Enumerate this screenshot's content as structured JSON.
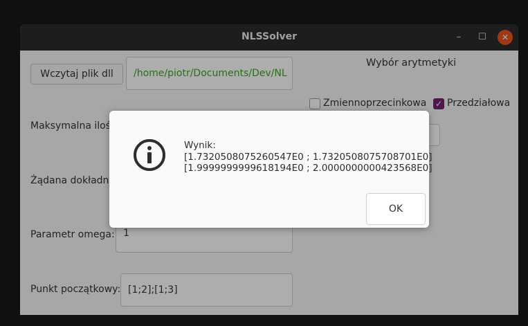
{
  "window": {
    "title": "NLSSolver",
    "minimize_glyph": "–",
    "maximize_glyph": "☐",
    "close_glyph": "✕"
  },
  "main": {
    "load_button_label": "Wczytaj plik dll",
    "dll_path_value": "/home/piotr/Documents/Dev/NL",
    "arithmetic_heading": "Wybór arytmetyki",
    "floating_label": "Zmiennoprzecinkowa",
    "interval_label": "Przedziałowa",
    "floating_checked": false,
    "interval_checked": true,
    "max_iter_label": "Maksymalna ilość iteracji:",
    "epsilon_label": "Żądana dokładność:",
    "omega_label": "Parametr omega:",
    "omega_value": "1",
    "start_point_label": "Punkt początkowy:",
    "start_point_value": "[1;2];[1;3]",
    "path_text_color": "#3aa61f"
  },
  "dialog": {
    "icon": "info-icon",
    "line1": "Wynik:",
    "line2": "[1.7320508075260547E0 ; 1.7320508075708701E0]",
    "line3": "[1.9999999999618194E0 ; 2.0000000000423568E0]",
    "ok_label": "OK"
  }
}
